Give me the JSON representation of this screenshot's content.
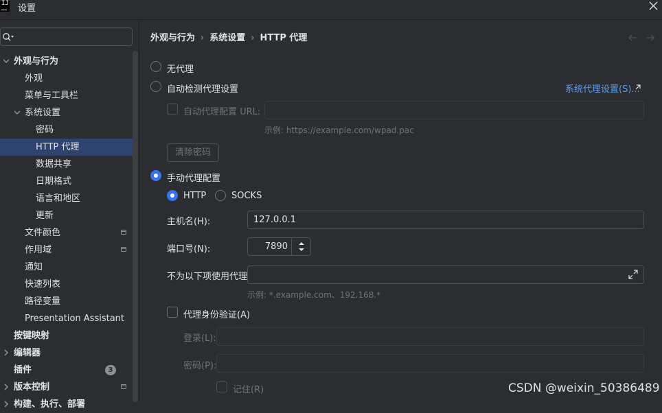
{
  "window": {
    "title": "设置",
    "logo_text": "IJ"
  },
  "search": {
    "placeholder": ""
  },
  "sidebar": {
    "items": [
      {
        "label": "外观与行为",
        "level": 0,
        "expanded": true,
        "bold": true
      },
      {
        "label": "外观",
        "level": 1
      },
      {
        "label": "菜单与工具栏",
        "level": 1
      },
      {
        "label": "系统设置",
        "level": 1,
        "expanded": true
      },
      {
        "label": "密码",
        "level": 2
      },
      {
        "label": "HTTP 代理",
        "level": 2,
        "selected": true
      },
      {
        "label": "数据共享",
        "level": 2
      },
      {
        "label": "日期格式",
        "level": 2
      },
      {
        "label": "语言和地区",
        "level": 2
      },
      {
        "label": "更新",
        "level": 2
      },
      {
        "label": "文件颜色",
        "level": 1,
        "project": true
      },
      {
        "label": "作用域",
        "level": 1,
        "project": true
      },
      {
        "label": "通知",
        "level": 1
      },
      {
        "label": "快速列表",
        "level": 1
      },
      {
        "label": "路径变量",
        "level": 1
      },
      {
        "label": "Presentation Assistant",
        "level": 1
      },
      {
        "label": "按键映射",
        "level": 0,
        "bold": true
      },
      {
        "label": "编辑器",
        "level": 0,
        "collapsed": true,
        "bold": true
      },
      {
        "label": "插件",
        "level": 0,
        "bold": true,
        "badge": "3"
      },
      {
        "label": "版本控制",
        "level": 0,
        "collapsed": true,
        "bold": true,
        "project": true
      },
      {
        "label": "构建、执行、部署",
        "level": 0,
        "collapsed": true,
        "bold": true
      }
    ]
  },
  "breadcrumb": [
    "外观与行为",
    "系统设置",
    "HTTP 代理"
  ],
  "proxy": {
    "no_proxy_label": "无代理",
    "auto_detect_label": "自动检测代理设置",
    "system_proxy_link": "系统代理设置(S)...",
    "auto_config_url_label": "自动代理配置 URL:",
    "auto_config_url_value": "",
    "auto_config_hint": "示例: https://example.com/wpad.pac",
    "clear_password_button": "清除密码",
    "manual_label": "手动代理配置",
    "http_label": "HTTP",
    "socks_label": "SOCKS",
    "host_label": "主机名(H):",
    "host_value": "127.0.0.1",
    "port_label": "端口号(N):",
    "port_value": "7890",
    "no_proxy_for_label": "不为以下项使用代理:",
    "no_proxy_for_value": "",
    "no_proxy_for_hint": "示例: *.example.com、192.168.*",
    "auth_label": "代理身份验证(A)",
    "login_label": "登录(L):",
    "login_value": "",
    "password_label": "密码(P):",
    "password_value": "",
    "remember_label": "记住(R)"
  },
  "watermark": "CSDN @weixin_50386489",
  "colors": {
    "accent": "#3574f0",
    "selection": "#2e436e",
    "link": "#589df6",
    "background": "#2b2d30"
  }
}
